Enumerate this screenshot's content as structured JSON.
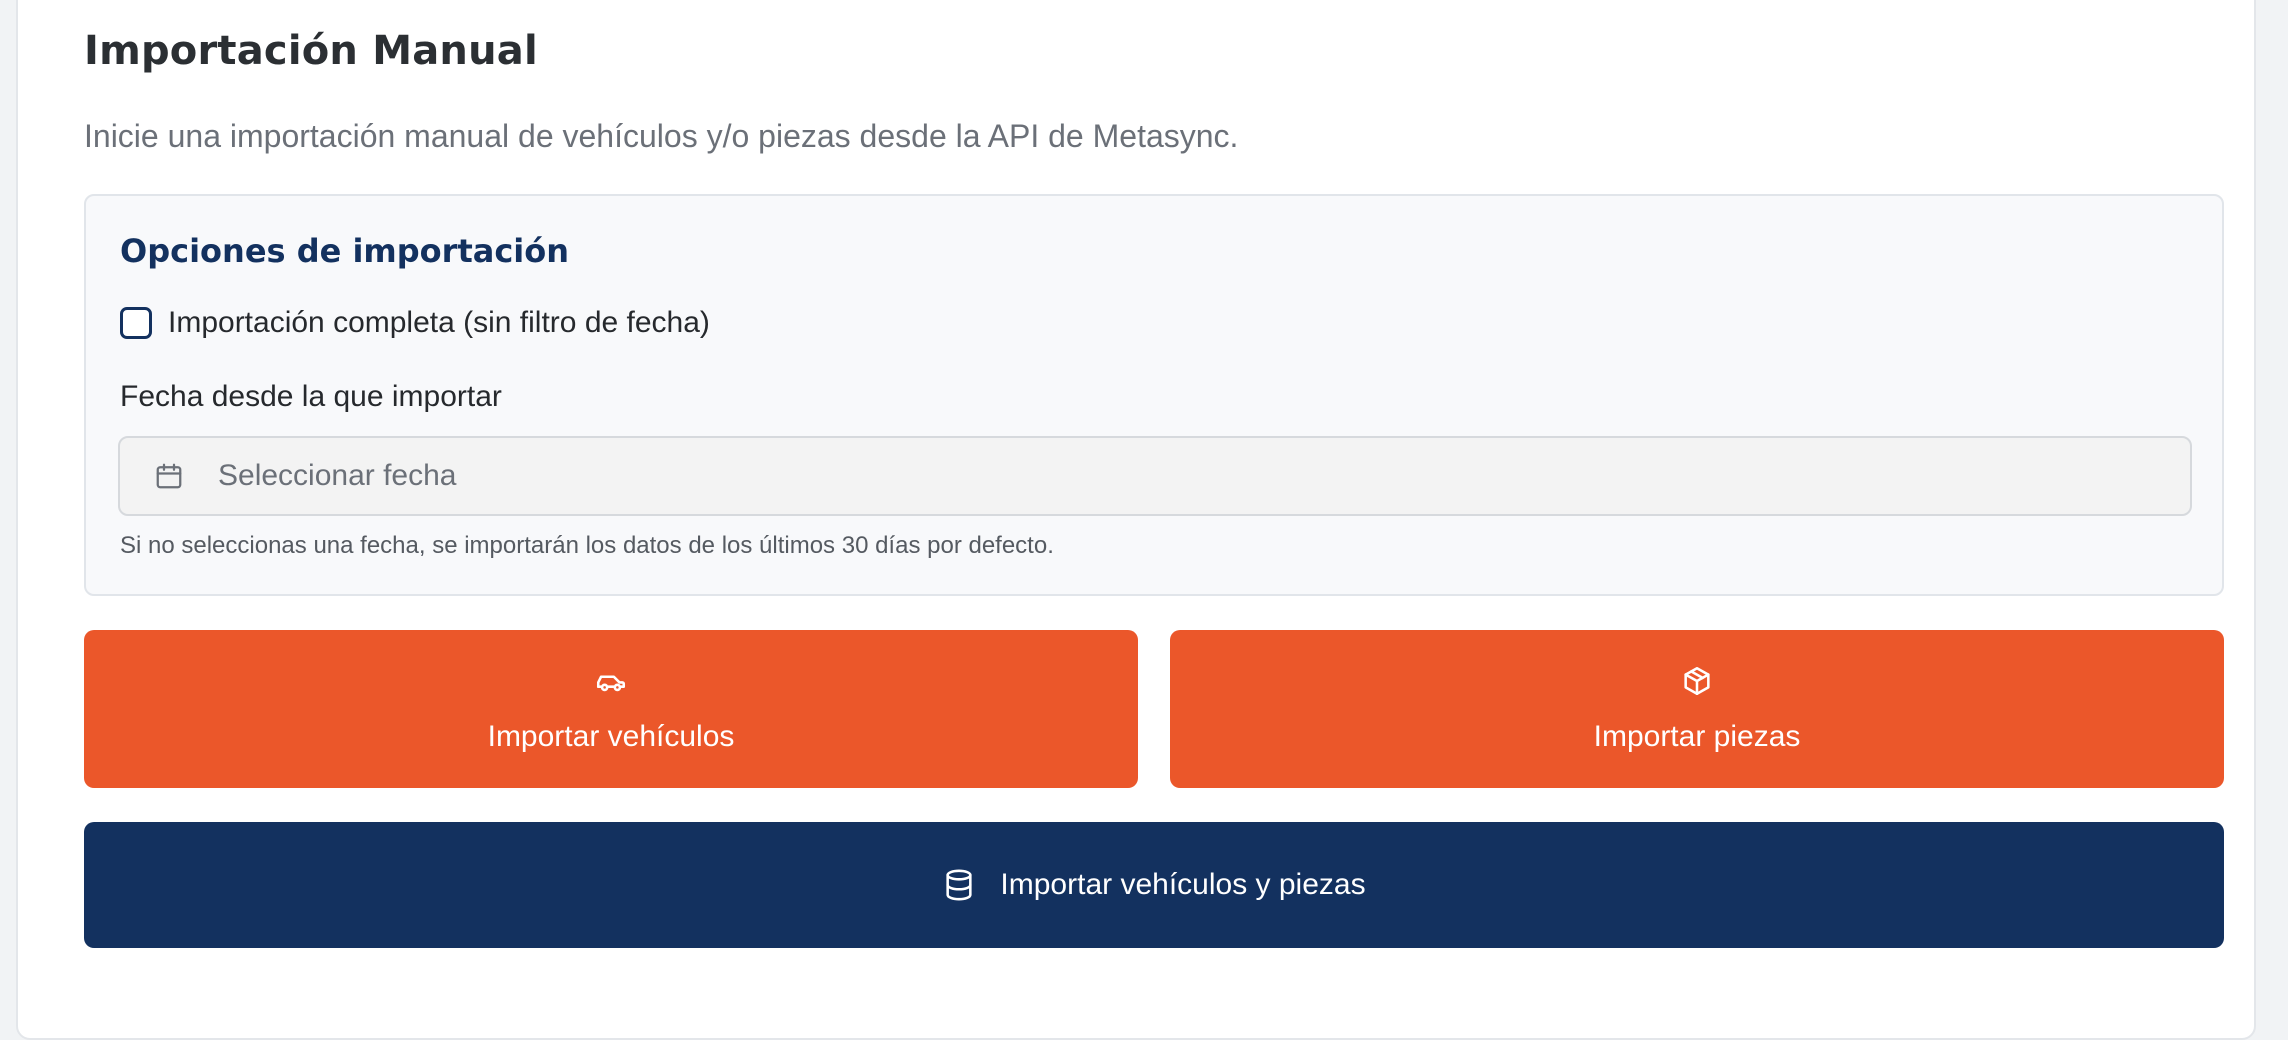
{
  "header": {
    "title": "Importación Manual",
    "subtitle": "Inicie una importación manual de vehículos y/o piezas desde la API de Metasync."
  },
  "options": {
    "title": "Opciones de importación",
    "full_import_label": "Importación completa (sin filtro de fecha)",
    "full_import_checked": false,
    "date_label": "Fecha desde la que importar",
    "date_placeholder": "Seleccionar fecha",
    "hint": "Si no seleccionas una fecha, se importarán los datos de los últimos 30 días por defecto."
  },
  "buttons": {
    "vehicles": {
      "label": "Importar vehículos",
      "icon": "car-icon"
    },
    "parts": {
      "label": "Importar piezas",
      "icon": "package-icon"
    },
    "all": {
      "label": "Importar vehículos y piezas",
      "icon": "database-icon"
    }
  },
  "colors": {
    "accent_orange": "#eb572a",
    "primary_navy": "#13315f"
  }
}
